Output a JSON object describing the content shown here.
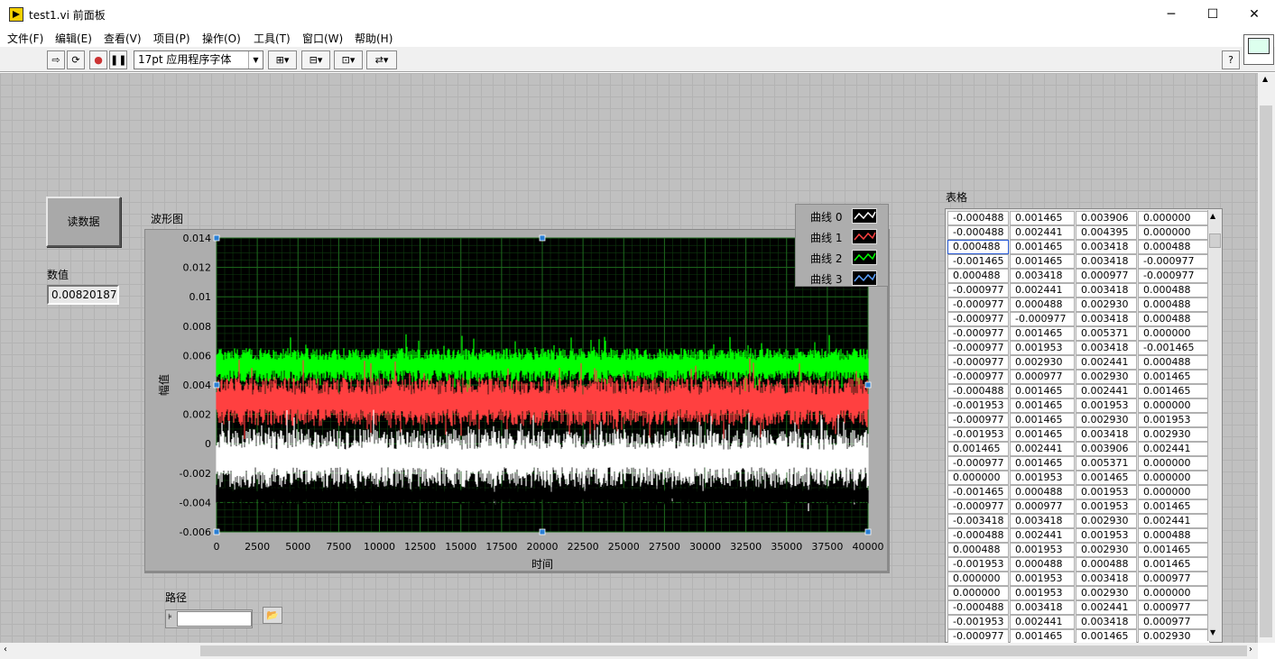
{
  "window": {
    "title": "test1.vi 前面板",
    "minimize": "─",
    "maximize": "☐",
    "close": "✕"
  },
  "menu": [
    "文件(F)",
    "编辑(E)",
    "查看(V)",
    "项目(P)",
    "操作(O)",
    "工具(T)",
    "窗口(W)",
    "帮助(H)"
  ],
  "toolbar": {
    "font_selector": "17pt 应用程序字体",
    "help": "?"
  },
  "controls": {
    "read_button": "读数据",
    "numeric_label": "数值",
    "numeric_value": "0.00820187",
    "path_label": "路径",
    "table_label": "表格"
  },
  "colors": {
    "plot_bg": "#000000",
    "grid": "#1d6a1d",
    "curve0": "#ffffff",
    "curve1": "#ff4040",
    "curve2": "#00ff00",
    "curve3": "#000000"
  },
  "chart_data": {
    "type": "line",
    "title": "波形图",
    "xlabel": "时间",
    "ylabel": "幅值",
    "xlim": [
      0,
      40000
    ],
    "ylim": [
      -0.006,
      0.014
    ],
    "x_ticks": [
      0,
      2500,
      5000,
      7500,
      10000,
      12500,
      15000,
      17500,
      20000,
      22500,
      25000,
      27500,
      30000,
      32500,
      35000,
      37500,
      40000
    ],
    "y_ticks": [
      "0.014",
      "0.012",
      "0.01",
      "0.008",
      "0.006",
      "0.004",
      "0.002",
      "0",
      "-0.002",
      "-0.004",
      "-0.006"
    ],
    "grid": true,
    "legend_placement": "top-right",
    "series": [
      {
        "name": "曲线 0",
        "color": "#ffffff",
        "band": [
          -0.003,
          0.001
        ]
      },
      {
        "name": "曲线 1",
        "color": "#ff4040",
        "band": [
          0.0012,
          0.0045
        ]
      },
      {
        "name": "曲线 2",
        "color": "#00ff00",
        "band": [
          0.0042,
          0.0065
        ]
      },
      {
        "name": "曲线 3",
        "color": "#000000",
        "band": [
          -0.0042,
          -0.0028
        ]
      }
    ]
  },
  "table": {
    "rows": [
      [
        "-0.000488",
        "0.001465",
        "0.003906",
        "0.000000"
      ],
      [
        "-0.000488",
        "0.002441",
        "0.004395",
        "0.000000"
      ],
      [
        "0.000488",
        "0.001465",
        "0.003418",
        "0.000488"
      ],
      [
        "-0.001465",
        "0.001465",
        "0.003418",
        "-0.000977"
      ],
      [
        "0.000488",
        "0.003418",
        "0.000977",
        "-0.000977"
      ],
      [
        "-0.000977",
        "0.002441",
        "0.003418",
        "0.000488"
      ],
      [
        "-0.000977",
        "0.000488",
        "0.002930",
        "0.000488"
      ],
      [
        "-0.000977",
        "-0.000977",
        "0.003418",
        "0.000488"
      ],
      [
        "-0.000977",
        "0.001465",
        "0.005371",
        "0.000000"
      ],
      [
        "-0.000977",
        "0.001953",
        "0.003418",
        "-0.001465"
      ],
      [
        "-0.000977",
        "0.002930",
        "0.002441",
        "0.000488"
      ],
      [
        "-0.000977",
        "0.000977",
        "0.002930",
        "0.001465"
      ],
      [
        "-0.000488",
        "0.001465",
        "0.002441",
        "0.001465"
      ],
      [
        "-0.001953",
        "0.001465",
        "0.001953",
        "0.000000"
      ],
      [
        "-0.000977",
        "0.001465",
        "0.002930",
        "0.001953"
      ],
      [
        "-0.001953",
        "0.001465",
        "0.003418",
        "0.002930"
      ],
      [
        "0.001465",
        "0.002441",
        "0.003906",
        "0.002441"
      ],
      [
        "-0.000977",
        "0.001465",
        "0.005371",
        "0.000000"
      ],
      [
        "0.000000",
        "0.001953",
        "0.001465",
        "0.000000"
      ],
      [
        "-0.001465",
        "0.000488",
        "0.001953",
        "0.000000"
      ],
      [
        "-0.000977",
        "0.000977",
        "0.001953",
        "0.001465"
      ],
      [
        "-0.003418",
        "0.003418",
        "0.002930",
        "0.002441"
      ],
      [
        "-0.000488",
        "0.002441",
        "0.001953",
        "0.000488"
      ],
      [
        "0.000488",
        "0.001953",
        "0.002930",
        "0.001465"
      ],
      [
        "-0.001953",
        "0.000488",
        "0.000488",
        "0.001465"
      ],
      [
        "0.000000",
        "0.001953",
        "0.003418",
        "0.000977"
      ],
      [
        "0.000000",
        "0.001953",
        "0.002930",
        "0.000000"
      ],
      [
        "-0.000488",
        "0.003418",
        "0.002441",
        "0.000977"
      ],
      [
        "-0.001953",
        "0.002441",
        "0.003418",
        "0.000977"
      ],
      [
        "-0.000977",
        "0.001465",
        "0.001465",
        "0.002930"
      ]
    ]
  }
}
